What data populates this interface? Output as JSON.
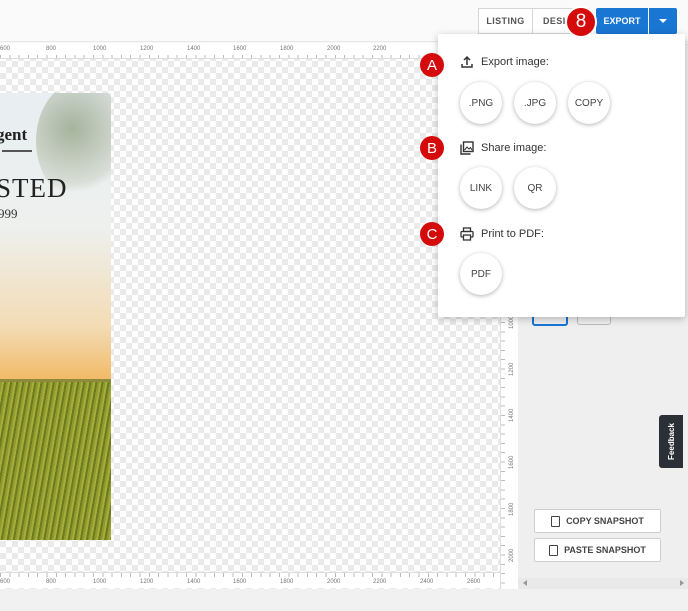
{
  "toolbar": {
    "tabs": [
      "LISTING",
      "DESIGN"
    ],
    "export_label": "EXPORT"
  },
  "ruler": {
    "top": [
      "600",
      "800",
      "1000",
      "1200",
      "1400",
      "1600",
      "1800",
      "2000",
      "2200"
    ],
    "bottom": [
      "600",
      "800",
      "1000",
      "1200",
      "1400",
      "1600",
      "1800",
      "2000",
      "2200",
      "2400",
      "2600"
    ],
    "right": [
      "1000",
      "1200",
      "1400",
      "1600",
      "1800",
      "2000"
    ]
  },
  "canvas": {
    "brand_text": "gent",
    "headline": "STED",
    "price": "999"
  },
  "export_menu": {
    "export_image": {
      "label": "Export image:",
      "options": [
        ".PNG",
        ".JPG",
        "COPY"
      ]
    },
    "share_image": {
      "label": "Share image:",
      "options": [
        "LINK",
        "QR"
      ]
    },
    "print_pdf": {
      "label": "Print to PDF:",
      "options": [
        "PDF"
      ]
    }
  },
  "annotations": {
    "step": "8",
    "markers": [
      "A",
      "B",
      "C"
    ],
    "color": "#d50b0b"
  },
  "side": {
    "copy_snapshot": "COPY SNAPSHOT",
    "paste_snapshot": "PASTE SNAPSHOT",
    "feedback": "Feedback"
  },
  "colors": {
    "accent": "#1976d2"
  }
}
